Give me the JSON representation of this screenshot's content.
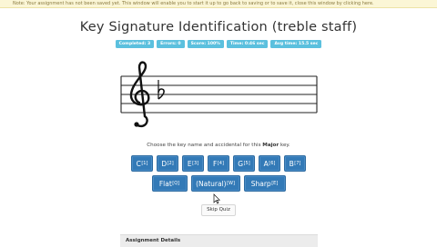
{
  "notice": {
    "text": "Note: Your assignment has not been saved yet. This window will enable you to start it up to go back to saving or to save it, close this window by clicking here."
  },
  "title": "Key Signature Identification (treble staff)",
  "stats": [
    {
      "label": "Completed: 3"
    },
    {
      "label": "Errors: 0"
    },
    {
      "label": "Score: 100%"
    },
    {
      "label": "Time: 0:46 sec"
    },
    {
      "label": "Avg time: 15.5 sec"
    }
  ],
  "staff": {
    "clef_icon": "treble-clef-icon",
    "accidental_icon": "flat-sign-icon"
  },
  "prompt": {
    "before": "Choose the key name and accidental for this",
    "bold": "Major",
    "after": "key."
  },
  "key_buttons": [
    {
      "label": "C",
      "shortcut": "[1]"
    },
    {
      "label": "D",
      "shortcut": "[2]"
    },
    {
      "label": "E",
      "shortcut": "[3]"
    },
    {
      "label": "F",
      "shortcut": "[4]"
    },
    {
      "label": "G",
      "shortcut": "[5]"
    },
    {
      "label": "A",
      "shortcut": "[6]"
    },
    {
      "label": "B",
      "shortcut": "[7]"
    }
  ],
  "accidental_buttons": [
    {
      "label": "Flat",
      "shortcut": "[Q]"
    },
    {
      "label": "(Natural)",
      "shortcut": "[W]"
    },
    {
      "label": "Sharp",
      "shortcut": "[E]"
    }
  ],
  "skip_button": "Skip Quiz",
  "panel_title": "Assignment Details",
  "colors": {
    "primary": "#337ab7",
    "stat_badge": "#5bc0de"
  }
}
